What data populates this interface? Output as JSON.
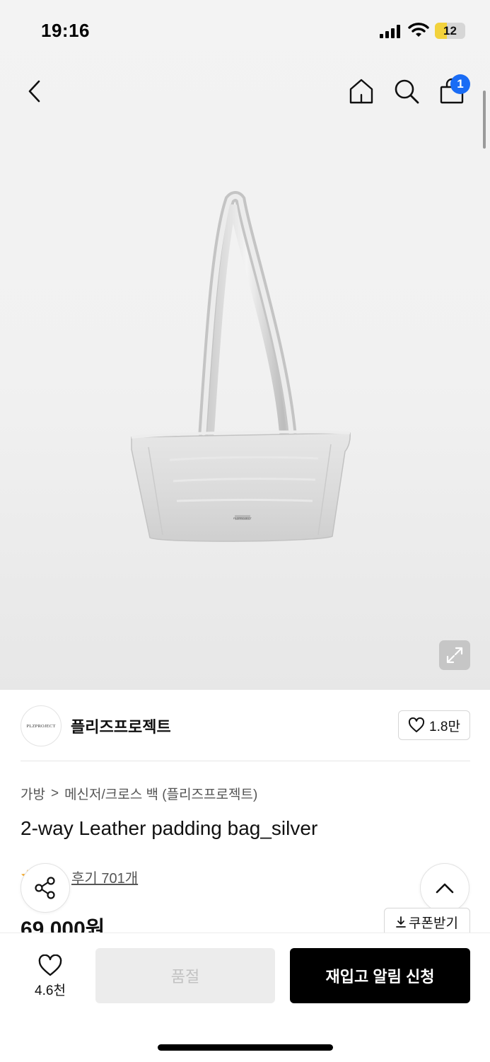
{
  "status_bar": {
    "time": "19:16",
    "battery": "12"
  },
  "nav": {
    "cart_count": "1"
  },
  "brand": {
    "name": "플리즈프로젝트",
    "logo_text": "PLZPROJECT",
    "like_count": "1.8만"
  },
  "breadcrumb": {
    "category": "가방",
    "separator": ">",
    "subcategory": "메신저/크로스 백 (플리즈프로젝트)"
  },
  "product": {
    "title": "2-way Leather padding bag_silver",
    "review_text": "후기 701개",
    "price": "69,000원",
    "coupon_label": "쿠폰받기",
    "image_tag": "PLZPROJECT"
  },
  "bottom_bar": {
    "wish_count": "4.6천",
    "soldout_label": "품절",
    "restock_label": "재입고 알림 신청"
  },
  "colors": {
    "accent": "#1a6cf5",
    "primary_button": "#000000",
    "disabled_button": "#ececec",
    "star": "#f5a623"
  },
  "icons": [
    "back-arrow-icon",
    "home-icon",
    "search-icon",
    "shopping-bag-icon",
    "expand-icon",
    "heart-icon",
    "share-icon",
    "chevron-up-icon",
    "download-icon",
    "star-icon"
  ]
}
